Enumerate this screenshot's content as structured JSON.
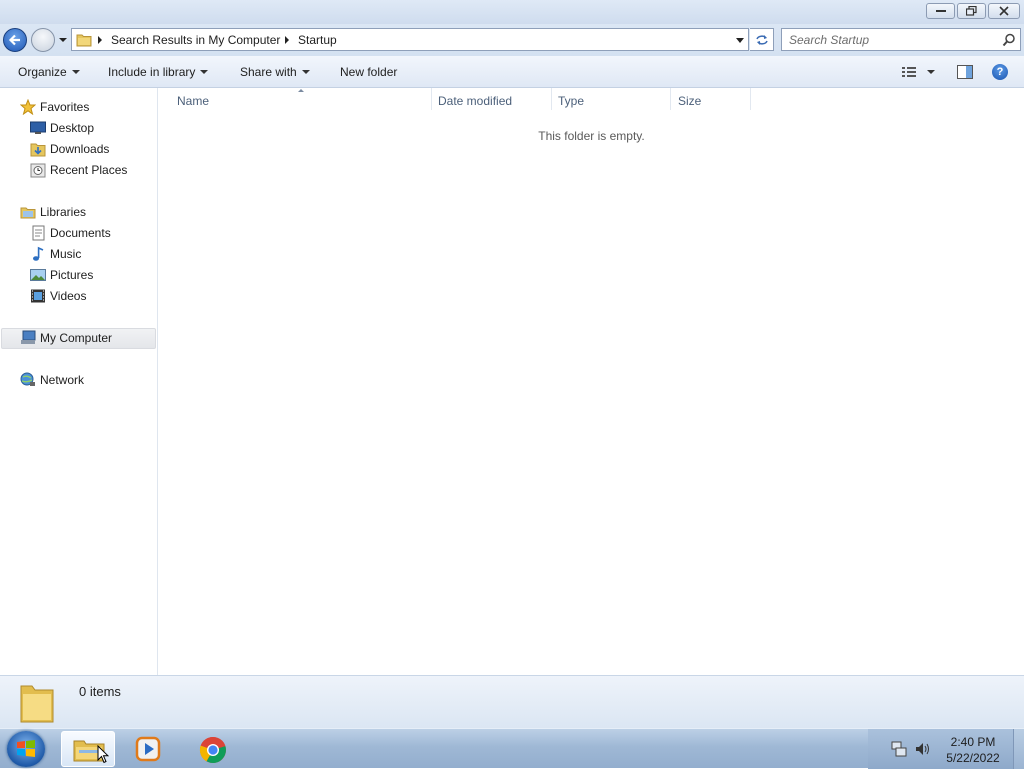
{
  "window": {
    "controls": {
      "minimize": "minimize",
      "maximize": "restore",
      "close": "close"
    }
  },
  "address": {
    "crumbs": [
      "Search Results in My Computer",
      "Startup"
    ],
    "search_placeholder": "Search Startup"
  },
  "commands": {
    "organize": "Organize",
    "include_in_library": "Include in library",
    "share_with": "Share with",
    "new_folder": "New folder"
  },
  "nav": {
    "favorites": {
      "label": "Favorites",
      "items": [
        "Desktop",
        "Downloads",
        "Recent Places"
      ]
    },
    "libraries": {
      "label": "Libraries",
      "items": [
        "Documents",
        "Music",
        "Pictures",
        "Videos"
      ]
    },
    "computer": "My Computer",
    "network": "Network",
    "selected": "My Computer"
  },
  "columns": [
    "Name",
    "Date modified",
    "Type",
    "Size"
  ],
  "content": {
    "empty_message": "This folder is empty."
  },
  "details": {
    "count": "0 items"
  },
  "taskbar": {
    "pinned": [
      "Windows Explorer",
      "Windows Media Player",
      "Google Chrome"
    ],
    "active": "Windows Explorer",
    "clock_time": "2:40 PM",
    "clock_date": "5/22/2022"
  },
  "colors": {
    "accent": "#1f57b5",
    "header_text": "#4c607a",
    "taskbar": "#9fb8d5"
  },
  "icons": [
    "star-icon",
    "desktop-icon",
    "downloads-icon",
    "recent-places-icon",
    "library-icon",
    "documents-icon",
    "music-icon",
    "pictures-icon",
    "videos-icon",
    "computer-icon",
    "network-icon",
    "folder-icon",
    "search-icon",
    "refresh-icon",
    "help-icon"
  ]
}
